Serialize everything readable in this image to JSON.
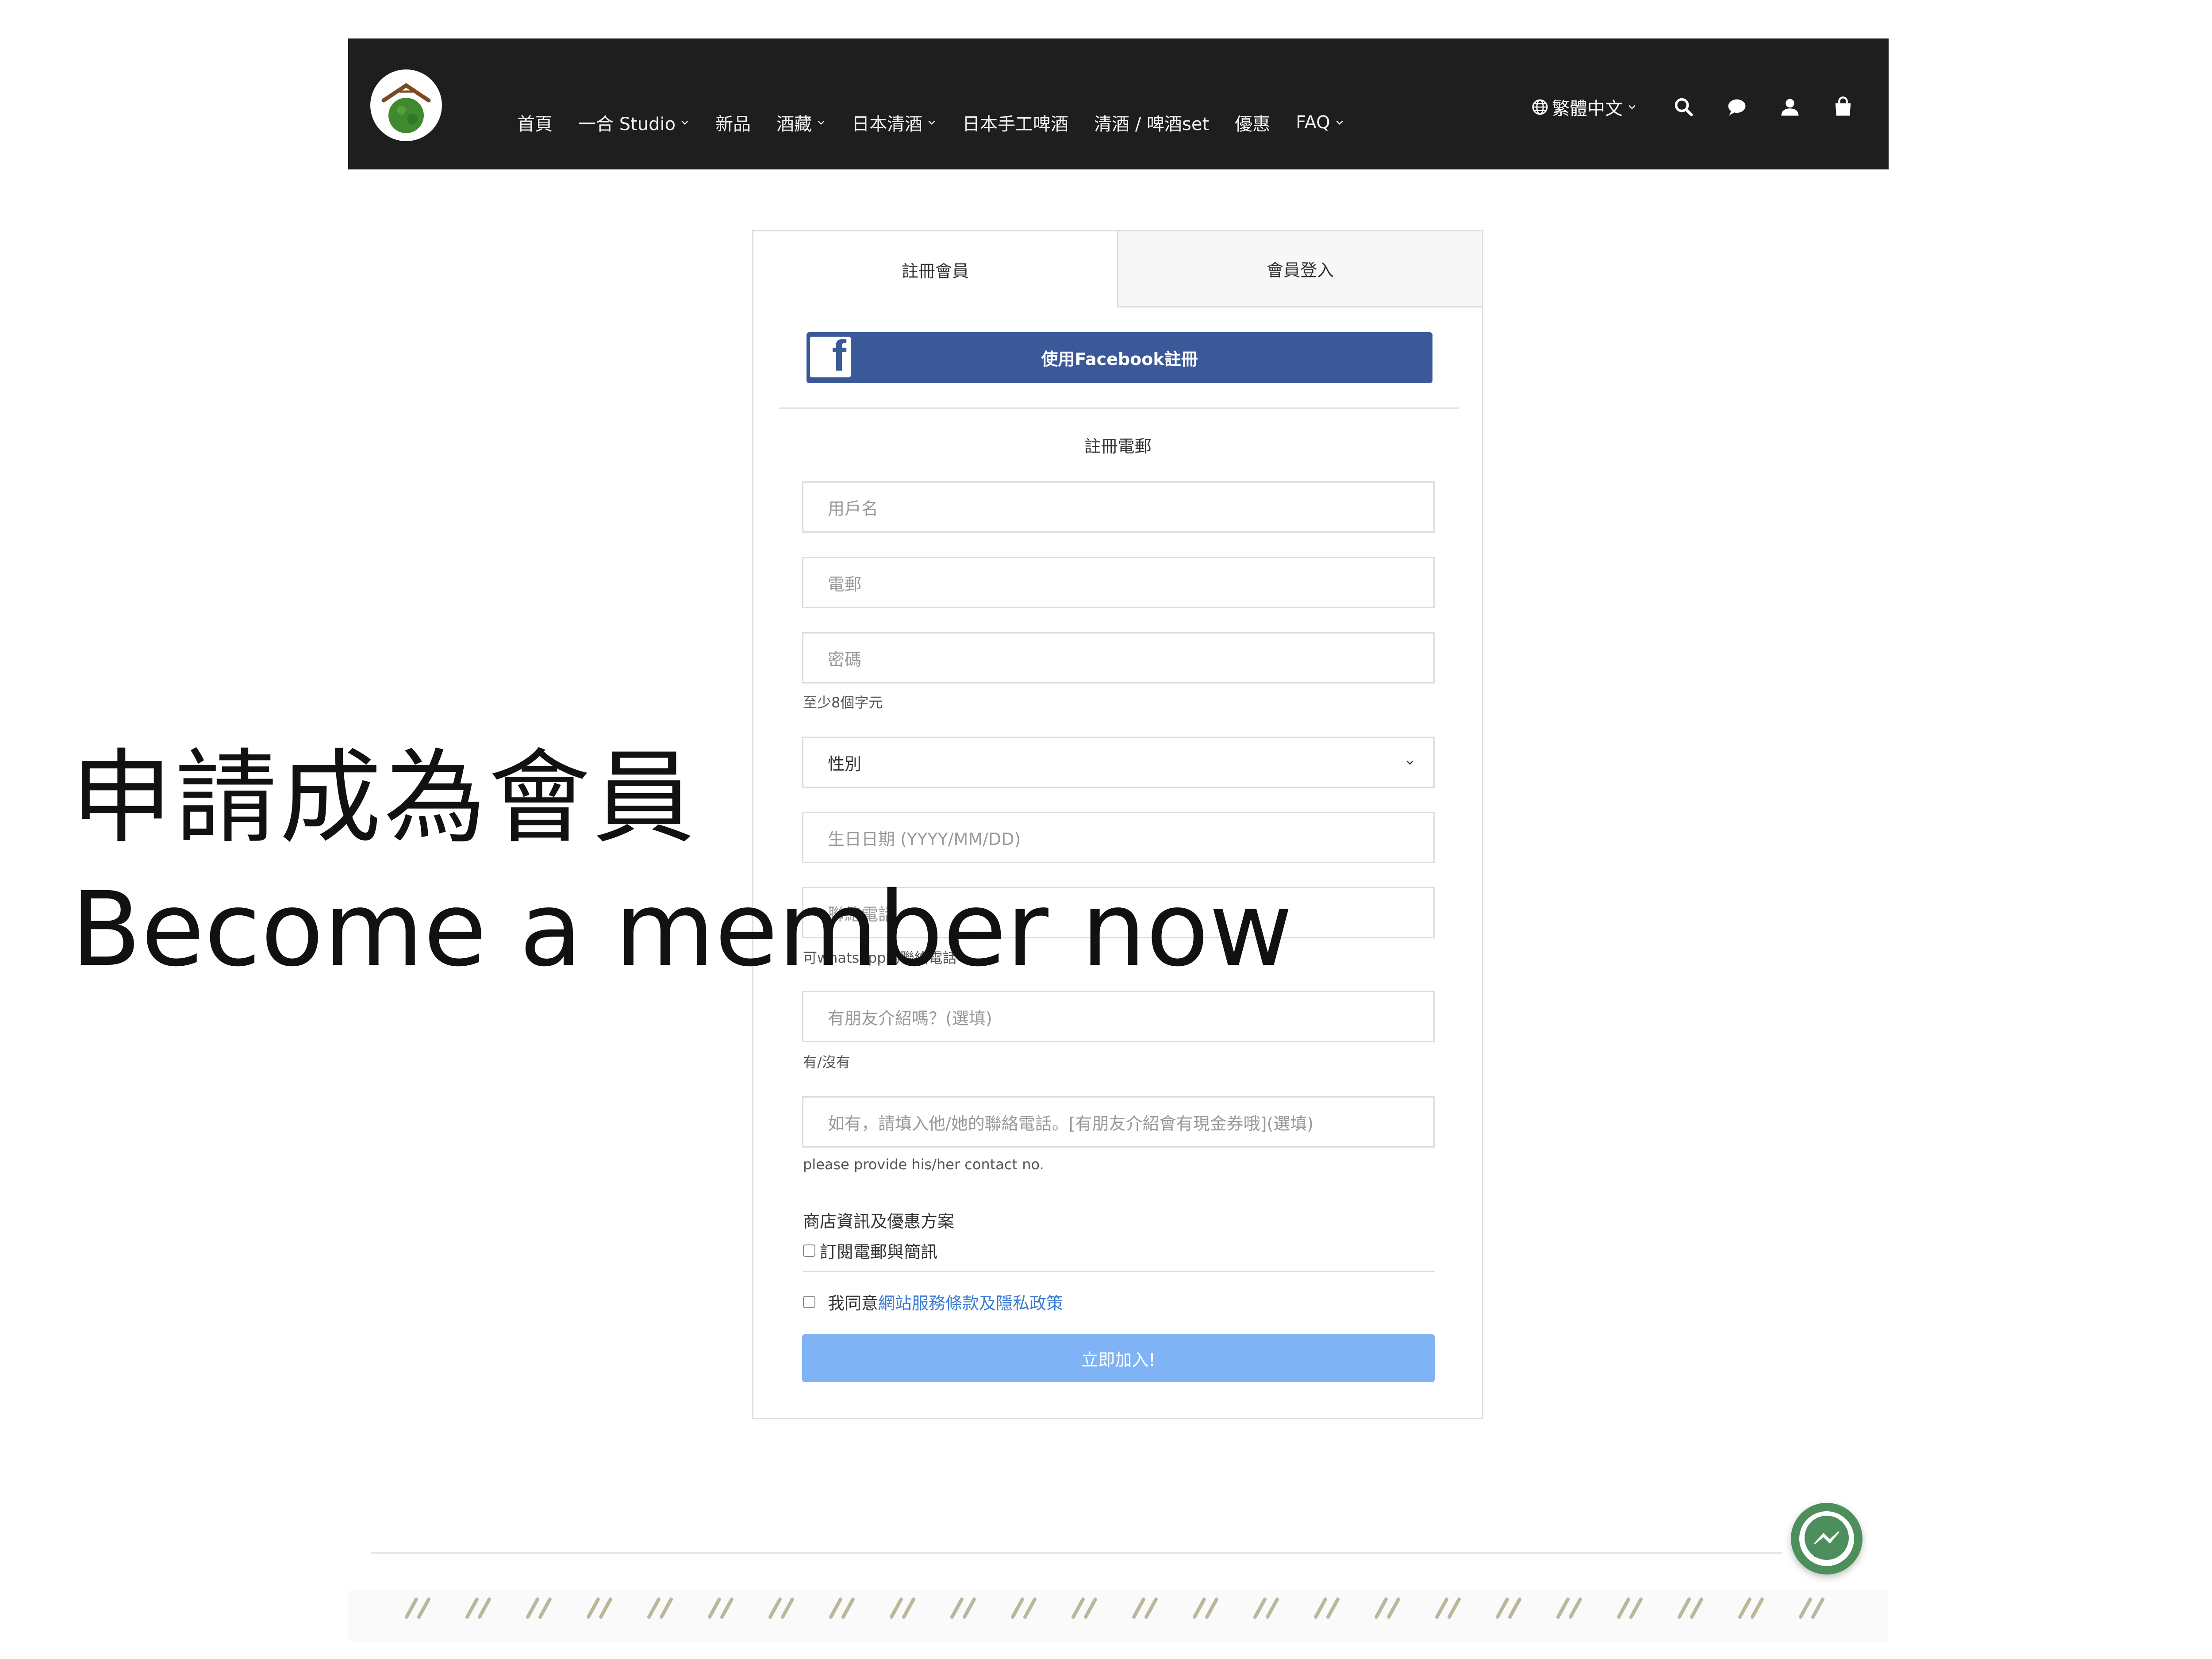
{
  "header": {
    "logo_name": "ichigo-studio-logo",
    "nav": [
      {
        "label": "首頁",
        "dropdown": false
      },
      {
        "label": "一合 Studio",
        "dropdown": true
      },
      {
        "label": "新品",
        "dropdown": false
      },
      {
        "label": "酒藏",
        "dropdown": true
      },
      {
        "label": "日本清酒",
        "dropdown": true
      },
      {
        "label": "日本手工啤酒",
        "dropdown": false
      },
      {
        "label": "清酒 / 啤酒set",
        "dropdown": false
      },
      {
        "label": "優惠",
        "dropdown": false
      },
      {
        "label": "FAQ",
        "dropdown": true
      }
    ],
    "language": "繁體中文",
    "icons": [
      "globe-icon",
      "search-icon",
      "chat-icon",
      "user-icon",
      "cart-icon"
    ],
    "background_color": "#1e1e1e"
  },
  "overlay": {
    "title_cn": "申請成為會員",
    "title_en": "Become a member now"
  },
  "register": {
    "tabs": [
      {
        "label": "註冊會員",
        "active": true
      },
      {
        "label": "會員登入",
        "active": false
      }
    ],
    "facebook_button": "使用Facebook註冊",
    "section_title": "註冊電郵",
    "fields": {
      "username": {
        "placeholder": "用戶名"
      },
      "email": {
        "placeholder": "電郵"
      },
      "password": {
        "placeholder": "密碼",
        "help": "至少8個字元"
      },
      "gender": {
        "value": "性別"
      },
      "birthday": {
        "placeholder": "生日日期 (YYYY/MM/DD)"
      },
      "phone": {
        "placeholder": "聯絡電話",
        "help": "可whatsapp的聯絡電話"
      },
      "referral": {
        "placeholder": "有朋友介紹嗎？(選填)",
        "help": "有/沒有"
      },
      "referral_phone": {
        "placeholder": "如有，請填入他/她的聯絡電話。[有朋友介紹會有現金券哦](選填)",
        "help": "please provide his/her contact no."
      }
    },
    "marketing_title": "商店資訊及優惠方案",
    "subscribe_label": "訂閱電郵與簡訊",
    "agree_prefix": "我同意",
    "agree_link": "網站服務條款及隱私政策",
    "submit_label": "立即加入!",
    "submit_color": "#7fb3f5",
    "facebook_color": "#3b5998"
  },
  "floating": {
    "messenger_icon": "messenger-icon",
    "messenger_color": "#4d8f5c"
  }
}
